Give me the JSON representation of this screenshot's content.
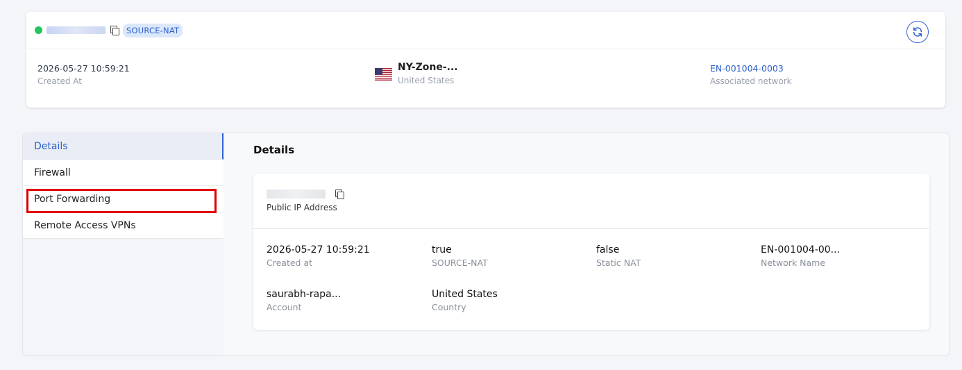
{
  "header": {
    "status_color": "#22c55e",
    "badge": "SOURCE-NAT",
    "refresh_icon": "refresh-icon",
    "created_at": "2026-05-27 10:59:21",
    "created_at_label": "Created At",
    "zone_name": "NY-Zone-...",
    "zone_country": "United States",
    "network_id": "EN-001004-0003",
    "network_label": "Associated network"
  },
  "nav": {
    "items": [
      {
        "label": "Details"
      },
      {
        "label": "Firewall"
      },
      {
        "label": "Port Forwarding"
      },
      {
        "label": "Remote Access VPNs"
      }
    ]
  },
  "details": {
    "title": "Details",
    "public_ip_label": "Public IP Address",
    "fields": [
      {
        "value": "2026-05-27 10:59:21",
        "label": "Created at"
      },
      {
        "value": "true",
        "label": "SOURCE-NAT"
      },
      {
        "value": "false",
        "label": "Static NAT"
      },
      {
        "value": "EN-001004-00...",
        "label": "Network Name"
      },
      {
        "value": "saurabh-rapa...",
        "label": "Account"
      },
      {
        "value": "United States",
        "label": "Country"
      }
    ]
  },
  "colors": {
    "accent": "#2f62d0",
    "highlight": "#e00000"
  }
}
